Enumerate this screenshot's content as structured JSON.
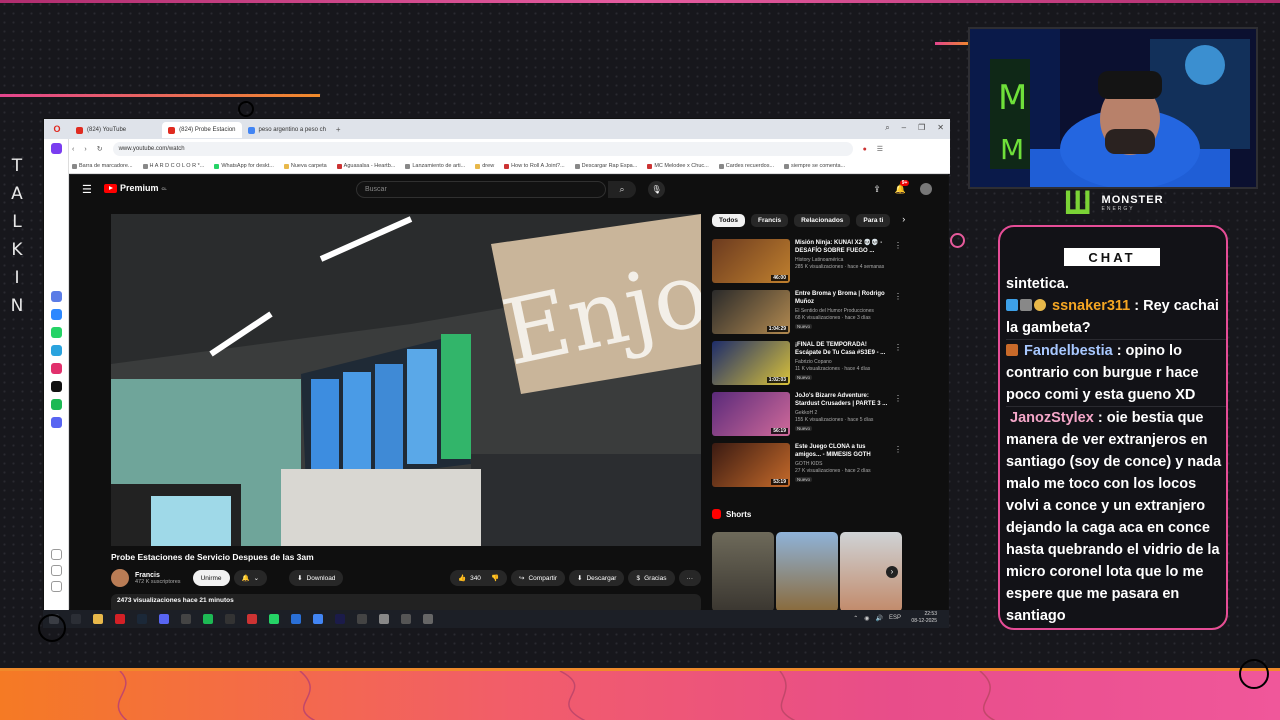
{
  "overlay": {
    "side_text": [
      "T",
      "A",
      "L",
      "K",
      "I",
      "N"
    ],
    "accent_colors": {
      "pink": "#e64d97",
      "orange": "#f08a2a",
      "monster_green": "#7bd336"
    }
  },
  "browser": {
    "tabs": [
      {
        "label": "(824) YouTube"
      },
      {
        "label": "(824) Probe Estacion"
      },
      {
        "label": "peso argentino a peso ch"
      }
    ],
    "url": "www.youtube.com/watch",
    "bookmarks": [
      "Barra de marcadore...",
      "H A R D C O L O R *...",
      "WhatsApp for deskt...",
      "Nueva carpeta",
      "Aguasalsa - Heartb...",
      "Lanzamiento de arti...",
      "drew",
      "How to Roll A Joint?...",
      "Descargar Rap Espa...",
      "MC Melodee x Chuc...",
      "Cardes recuerdos...",
      "siempre se comenta..."
    ]
  },
  "youtube": {
    "brand": "Premium",
    "brand_suffix": "CL",
    "search_placeholder": "Buscar",
    "notif_count": "9+",
    "video": {
      "title": "Probe Estaciones de Servicio Despues de las 3am",
      "channel": "Francis",
      "subscribers": "472 K suscriptores",
      "join_label": "Unirme",
      "download_label": "Download",
      "likes": "340",
      "share_label": "Compartir",
      "save_label": "Descargar",
      "thanks_label": "Gracias",
      "description_meta": "2473 visualizaciones  hace 21 minutos"
    },
    "chips": [
      "Todos",
      "Francis",
      "Relacionados",
      "Para ti"
    ],
    "recommendations": [
      {
        "title": "Misión Ninja: KUNAI X2 💀💀 - DESAFÍO SOBRE FUEGO ...",
        "channel": "History Latinoamérica",
        "meta": "285 K visualizaciones · hace 4 semanas",
        "duration": "46:00",
        "badge": ""
      },
      {
        "title": "Entre Broma y Broma | Rodrigo Muñoz",
        "channel": "El Sentido del Humor Producciones",
        "meta": "68 K visualizaciones · hace 3 días",
        "duration": "1:04:29",
        "badge": "Nuevo"
      },
      {
        "title": "¡FINAL DE TEMPORADA! Escápate De Tu Casa #S3E9 - ...",
        "channel": "Fabrizio Copano",
        "meta": "11 K visualizaciones · hace 4 días",
        "duration": "1:02:03",
        "badge": "Nuevo"
      },
      {
        "title": "JoJo's Bizarre Adventure: Stardust Crusaders | PARTE 3 ...",
        "channel": "GekkoH 2",
        "meta": "155 K visualizaciones · hace 5 días",
        "duration": "56:19",
        "badge": "Nuevo"
      },
      {
        "title": "Este Juego CLONA a tus amigos... - MIMESIS GOTH",
        "channel": "GOTH KIDS",
        "meta": "27 K visualizaciones · hace 2 días",
        "duration": "53:19",
        "badge": "Nuevo"
      }
    ],
    "shorts_label": "Shorts"
  },
  "taskbar": {
    "lang": "ESP",
    "time": "22:53",
    "date": "08-12-2025"
  },
  "stream": {
    "sponsor": "MONSTER",
    "sponsor_sub": "ENERGY",
    "chat_title": "CHAT",
    "messages": [
      {
        "user": "",
        "text": "sintetica.",
        "user_color": "#ffffff"
      },
      {
        "user": "ssnaker311",
        "text": ": Rey cachai la gambeta?",
        "user_color": "#f5a623"
      },
      {
        "user": "Fandelbestia",
        "text": ": opino lo contrario con burgue r hace poco comi y esta gueno XD",
        "user_color": "#a8c8ff"
      },
      {
        "user": "JanozStylex",
        "text": ": oie bestia que manera de ver extranjeros en santiago (soy de conce) y nada malo me toco con los locos volvi a conce y un extranjero dejando la caga aca en conce hasta quebrando el vidrio de la micro coronel lota que lo me espere que me pasara en santiago",
        "user_color": "#f4a6c8"
      }
    ]
  }
}
